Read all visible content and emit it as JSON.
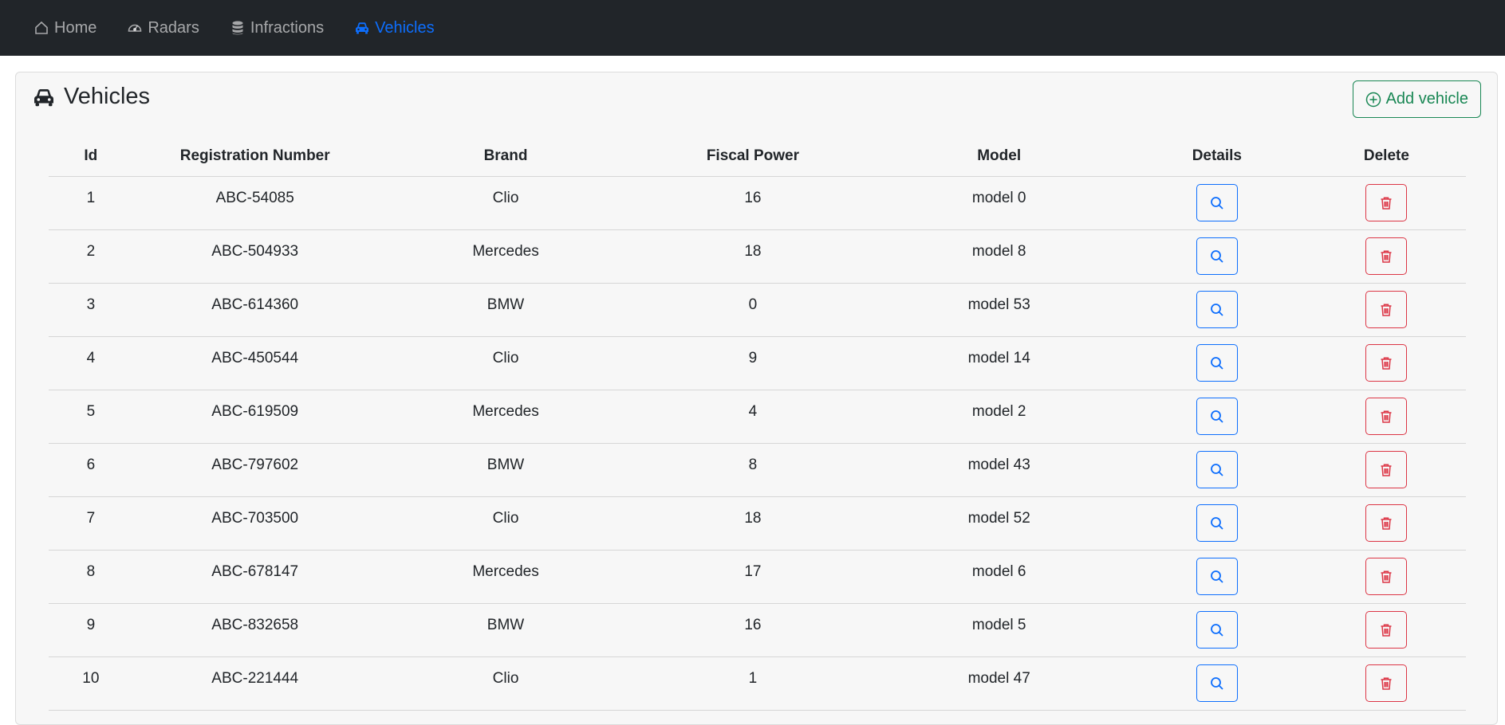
{
  "nav": {
    "items": [
      {
        "label": "Home",
        "icon": "home-icon"
      },
      {
        "label": "Radars",
        "icon": "speedometer-icon"
      },
      {
        "label": "Infractions",
        "icon": "database-icon"
      },
      {
        "label": "Vehicles",
        "icon": "car-icon",
        "active": true
      }
    ]
  },
  "page": {
    "title": "Vehicles",
    "add_button": "Add vehicle"
  },
  "table": {
    "headers": [
      "Id",
      "Registration Number",
      "Brand",
      "Fiscal Power",
      "Model",
      "Details",
      "Delete"
    ],
    "rows": [
      {
        "id": "1",
        "reg": "ABC-54085",
        "brand": "Clio",
        "power": "16",
        "model": "model 0"
      },
      {
        "id": "2",
        "reg": "ABC-504933",
        "brand": "Mercedes",
        "power": "18",
        "model": "model 8"
      },
      {
        "id": "3",
        "reg": "ABC-614360",
        "brand": "BMW",
        "power": "0",
        "model": "model 53"
      },
      {
        "id": "4",
        "reg": "ABC-450544",
        "brand": "Clio",
        "power": "9",
        "model": "model 14"
      },
      {
        "id": "5",
        "reg": "ABC-619509",
        "brand": "Mercedes",
        "power": "4",
        "model": "model 2"
      },
      {
        "id": "6",
        "reg": "ABC-797602",
        "brand": "BMW",
        "power": "8",
        "model": "model 43"
      },
      {
        "id": "7",
        "reg": "ABC-703500",
        "brand": "Clio",
        "power": "18",
        "model": "model 52"
      },
      {
        "id": "8",
        "reg": "ABC-678147",
        "brand": "Mercedes",
        "power": "17",
        "model": "model 6"
      },
      {
        "id": "9",
        "reg": "ABC-832658",
        "brand": "BMW",
        "power": "16",
        "model": "model 5"
      },
      {
        "id": "10",
        "reg": "ABC-221444",
        "brand": "Clio",
        "power": "1",
        "model": "model 47"
      }
    ]
  },
  "colors": {
    "navbar": "#212529",
    "active": "#0d6efd",
    "success": "#198754",
    "danger": "#dc3545"
  }
}
